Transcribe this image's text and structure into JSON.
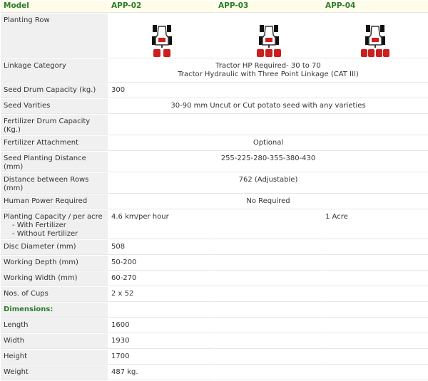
{
  "header": {
    "model": "Model",
    "app02": "APP-02",
    "app03": "APP-03",
    "app04": "APP-04"
  },
  "planting_row": {
    "label": "Planting Row",
    "icons": [
      "tractor-2-row-icon",
      "tractor-3-row-icon",
      "tractor-4-row-icon"
    ]
  },
  "linkage": {
    "label": "Linkage Category",
    "line1": "Tractor HP Required- 30 to 70",
    "line2": "Tractor Hydraulic with Three Point Linkage (CAT III)"
  },
  "seed_drum": {
    "label": "Seed Drum Capacity (kg.)",
    "value": "300"
  },
  "seed_varieties": {
    "label": "Seed Varities",
    "value": "30-90 mm Uncut or Cut potato seed with any varieties"
  },
  "fert_drum": {
    "label": "Fertilizer Drum Capacity (Kg.)"
  },
  "fert_attach": {
    "label": "Fertilizer Attachment",
    "value": "Optional"
  },
  "seed_distance": {
    "label": "Seed Planting Distance (mm)",
    "value": "255-225-280-355-380-430"
  },
  "row_distance": {
    "label": "Distance between Rows (mm)",
    "value": "762 (Adjustable)"
  },
  "human_power": {
    "label": "Human Power Required",
    "value": "No Required"
  },
  "planting_capacity": {
    "label": "Planting Capacity / per acre",
    "with": "- With Fertilizer",
    "without": "- Without Fertilizer",
    "app02": "4.6 km/per hour",
    "app04": "1 Acre"
  },
  "disc_diameter": {
    "label": "Disc Diameter (mm)",
    "value": "508"
  },
  "working_depth": {
    "label": "Working Depth (mm)",
    "value": "50-200"
  },
  "working_width": {
    "label": "Working Width (mm)",
    "value": "60-270"
  },
  "cups": {
    "label": "Nos. of Cups",
    "value": "2 x 52"
  },
  "dimensions": {
    "label": "Dimensions:"
  },
  "length": {
    "label": "Length",
    "value": "1600"
  },
  "width": {
    "label": "Width",
    "value": "1930"
  },
  "height": {
    "label": "Height",
    "value": "1700"
  },
  "weight": {
    "label": "Weight",
    "value": "487 kg."
  },
  "colors": {
    "heading": "#2b7d2b",
    "row_red": "#cc1f1f",
    "label_bg": "#f0f0f0",
    "header_bg": "#fffde9"
  }
}
